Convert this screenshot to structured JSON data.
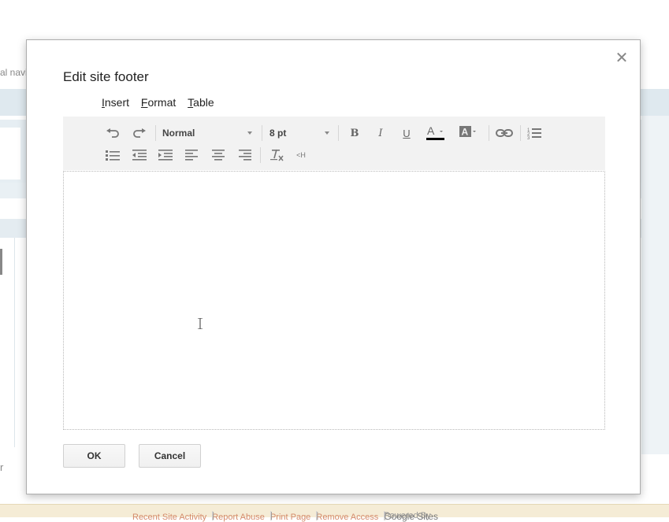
{
  "background": {
    "left_nav_fragment": "al navi",
    "left_edge_fragment": "r",
    "footer_links": [
      "Recent Site Activity",
      "Report Abuse",
      "Print Page",
      "Remove Access"
    ],
    "footer_separator": "|",
    "powered_by": "Powered By",
    "powered_by_brand": "Google Sites"
  },
  "dialog": {
    "title": "Edit site footer",
    "close_icon": "close-icon",
    "menus": [
      {
        "underline": "I",
        "rest": "nsert"
      },
      {
        "underline": "F",
        "rest": "ormat"
      },
      {
        "underline": "T",
        "rest": "able"
      }
    ],
    "toolbar": {
      "style_value": "Normal",
      "size_value": "8 pt",
      "icons": [
        "undo-icon",
        "redo-icon",
        "bold-icon",
        "italic-icon",
        "underline-icon",
        "text-color-icon",
        "highlight-color-icon",
        "link-icon",
        "numbered-list-icon",
        "bulleted-list-icon",
        "outdent-icon",
        "indent-icon",
        "align-left-icon",
        "align-center-icon",
        "align-right-icon",
        "clear-formatting-icon",
        "html-icon"
      ],
      "text_color": "#000000",
      "html_label": "<H"
    },
    "editor_content": "",
    "ok_label": "OK",
    "cancel_label": "Cancel"
  }
}
